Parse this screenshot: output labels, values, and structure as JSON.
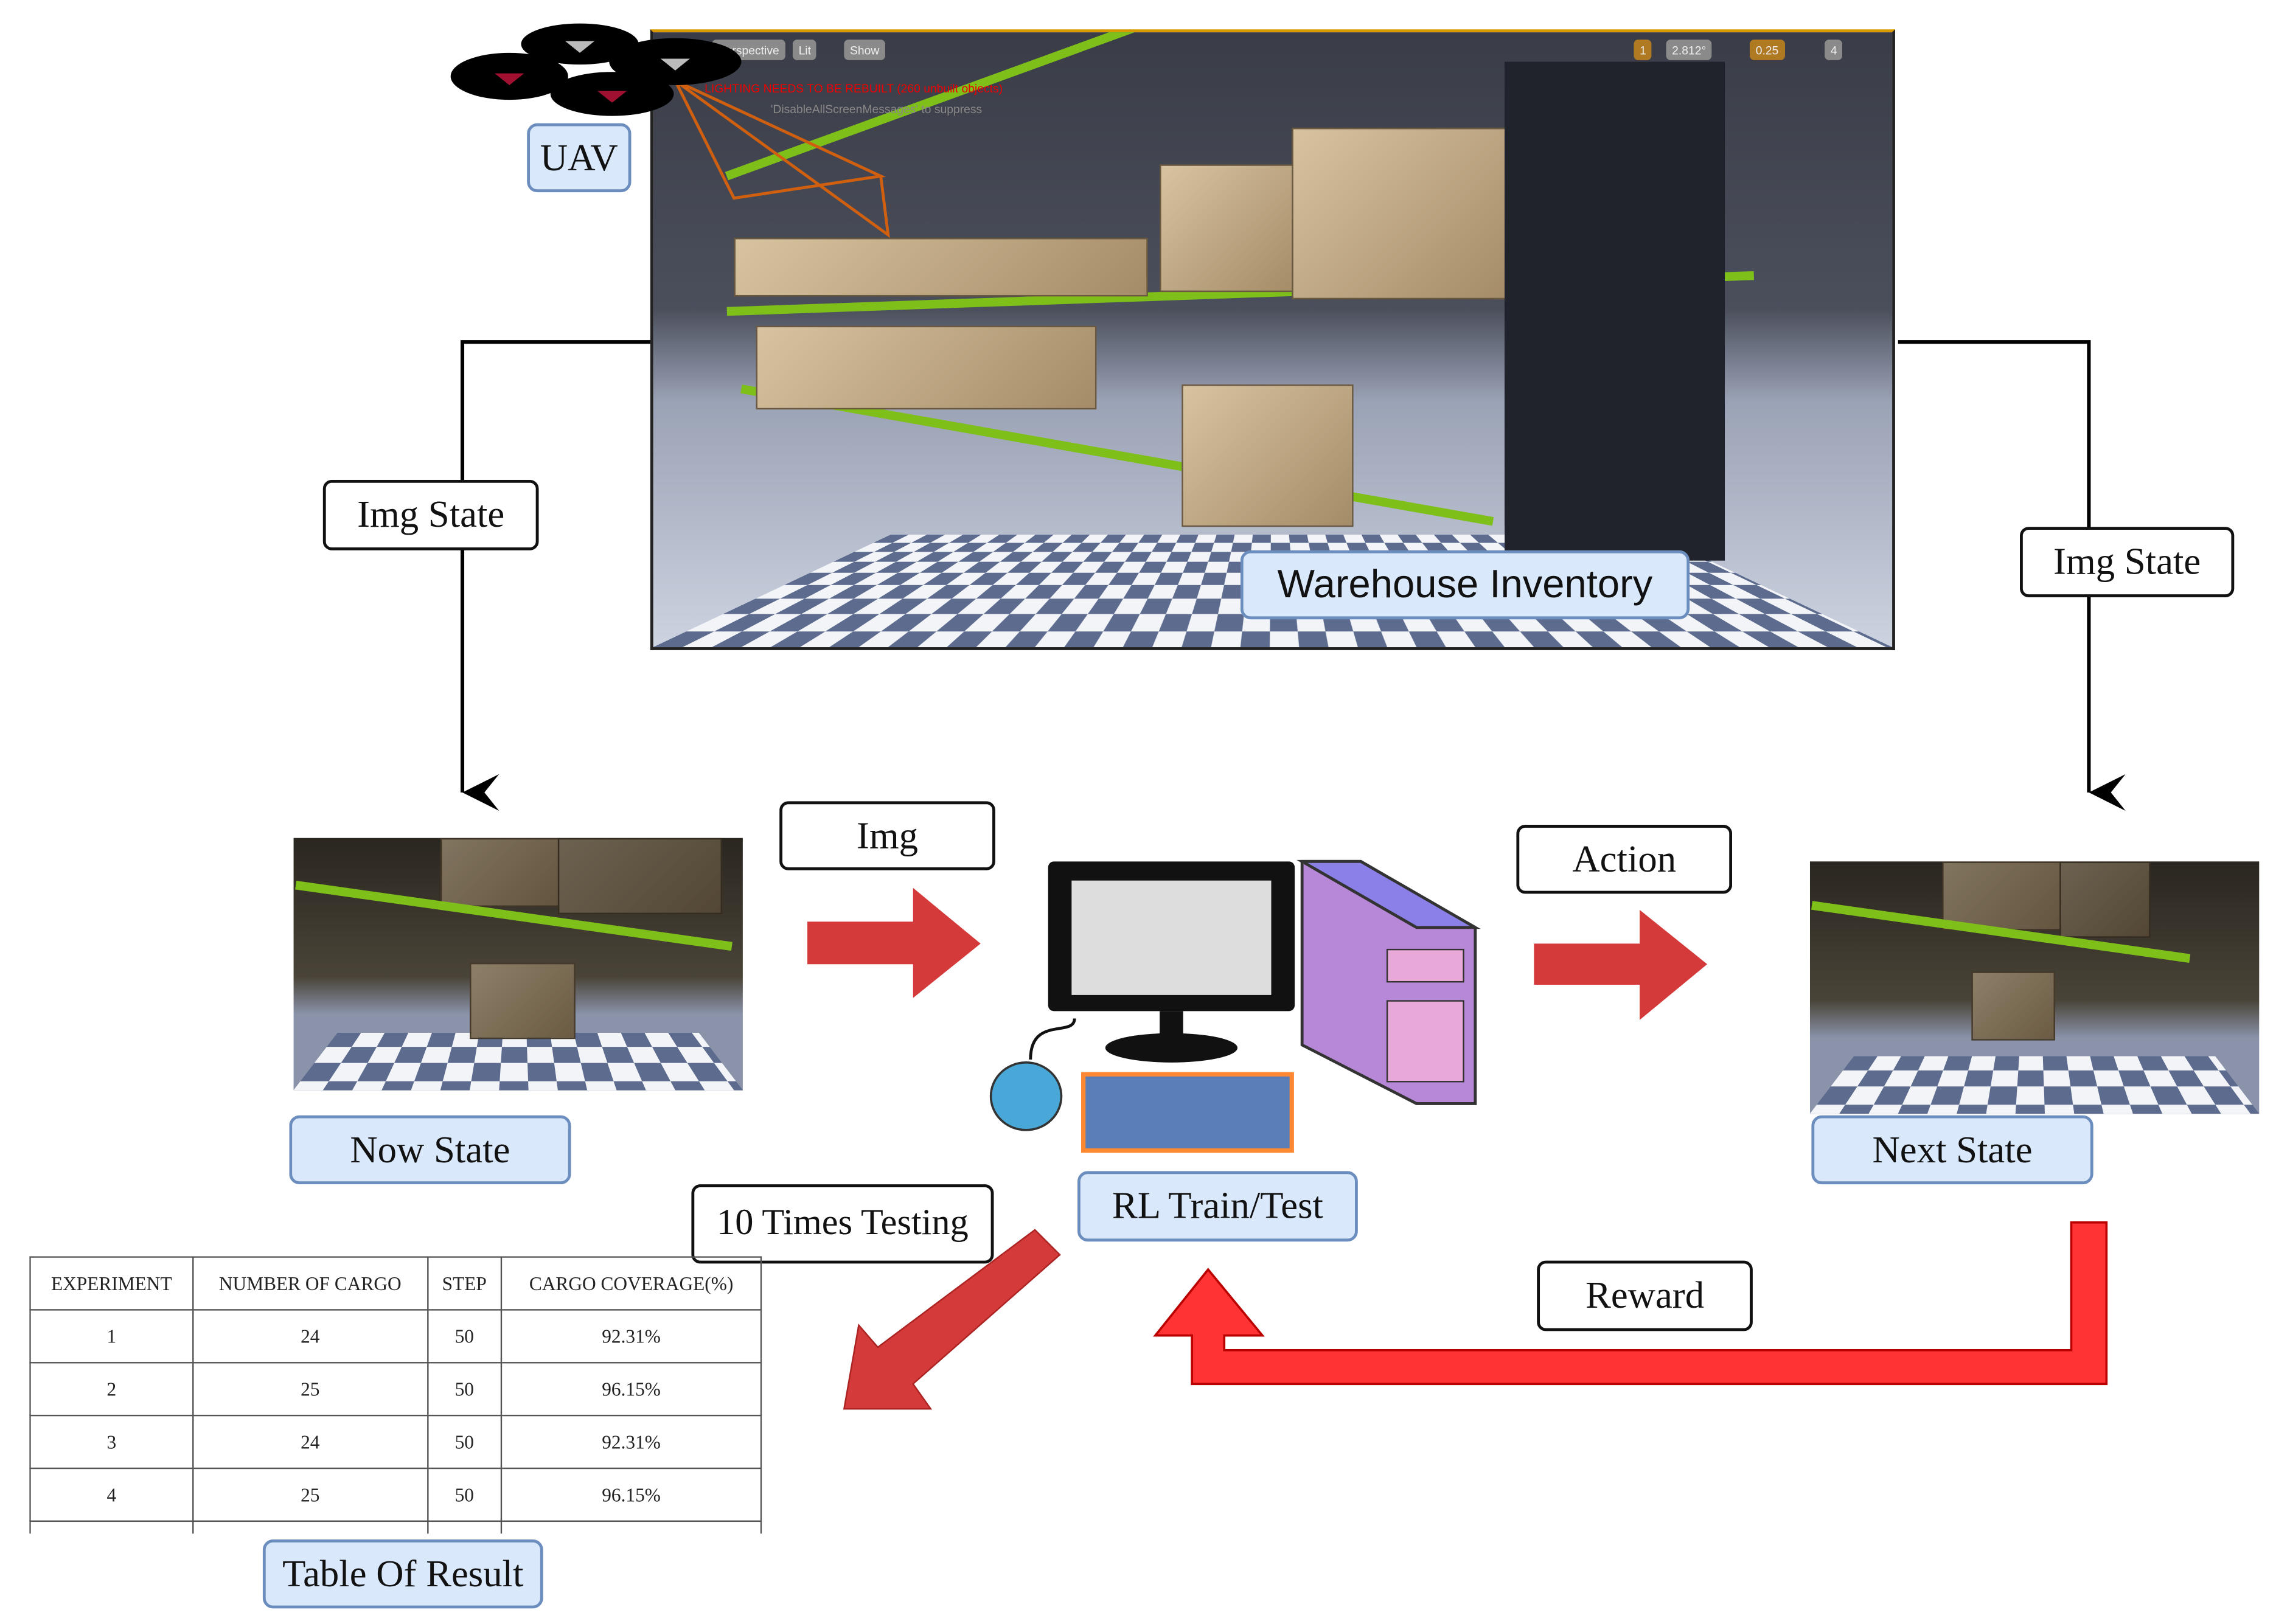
{
  "labels": {
    "uav": "UAV",
    "warehouse": "Warehouse Inventory",
    "img_state_left": "Img State",
    "img_state_right": "Img State",
    "now_state": "Now State",
    "next_state": "Next State",
    "img": "Img",
    "action": "Action",
    "rl": "RL Train/Test",
    "testing": "10 Times Testing",
    "reward": "Reward",
    "table_result": "Table Of Result"
  },
  "viewport": {
    "toolbar": [
      "Perspective",
      "Lit",
      "Show",
      "1",
      "2.812°",
      "0.25",
      "4"
    ],
    "warning": "LIGHTING NEEDS TO BE REBUILT (260 unbuilt objects)",
    "suppress": "'DisableAllScreenMessages' to suppress"
  },
  "table": {
    "headers": [
      "EXPERIMENT",
      "NUMBER OF CARGO",
      "STEP",
      "CARGO COVERAGE(%)"
    ],
    "rows": [
      [
        "1",
        "24",
        "50",
        "92.31%"
      ],
      [
        "2",
        "25",
        "50",
        "96.15%"
      ],
      [
        "3",
        "24",
        "50",
        "92.31%"
      ],
      [
        "4",
        "25",
        "50",
        "96.15%"
      ]
    ]
  },
  "colors": {
    "arrow_red": "#d43a3a",
    "reward_red": "#ff3333",
    "label_fill": "#dae8fc",
    "label_border": "#6c8ebf"
  }
}
